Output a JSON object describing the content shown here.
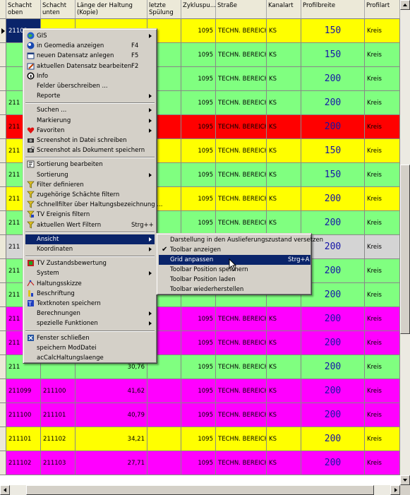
{
  "columns": [
    "",
    "Schacht oben",
    "Schacht unten",
    "Länge der Haltung (Kopie)",
    "letzte Spülung",
    "Zykluspu...",
    "Straße",
    "Kanalart",
    "Profilbreite",
    "Profilart"
  ],
  "colors": {
    "yellow": "#ffff00",
    "green": "#80ff80",
    "red": "#ff0000",
    "magenta": "#ff00ff",
    "grey": "#d4d4d4"
  },
  "rows": [
    {
      "c": "yellow",
      "s1": "21103",
      "s2": "",
      "len": "",
      "zy": "1095",
      "str": "TECHN. BEREICH",
      "ka": "KS",
      "pb": "150",
      "pa": "Kreis",
      "cur": true
    },
    {
      "c": "green",
      "s1": "",
      "s2": "",
      "len": "",
      "zy": "1095",
      "str": "TECHN. BEREICH",
      "ka": "KS",
      "pb": "150",
      "pa": "Kreis"
    },
    {
      "c": "green",
      "s1": "",
      "s2": "",
      "len": "",
      "zy": "1095",
      "str": "TECHN. BEREICH",
      "ka": "KS",
      "pb": "200",
      "pa": "Kreis"
    },
    {
      "c": "green",
      "s1": "211",
      "s2": "",
      "len": "",
      "zy": "1095",
      "str": "TECHN. BEREICH",
      "ka": "KS",
      "pb": "200",
      "pa": "Kreis"
    },
    {
      "c": "red",
      "s1": "211",
      "s2": "",
      "len": "",
      "zy": "1095",
      "str": "TECHN. BEREICH",
      "ka": "KS",
      "pb": "200",
      "pa": "Kreis"
    },
    {
      "c": "yellow",
      "s1": "211",
      "s2": "",
      "len": "",
      "zy": "1095",
      "str": "TECHN. BEREICH",
      "ka": "KS",
      "pb": "150",
      "pa": "Kreis"
    },
    {
      "c": "green",
      "s1": "211",
      "s2": "",
      "len": "",
      "zy": "1095",
      "str": "TECHN. BEREICH",
      "ka": "KS",
      "pb": "150",
      "pa": "Kreis"
    },
    {
      "c": "yellow",
      "s1": "211",
      "s2": "",
      "len": "",
      "zy": "1095",
      "str": "TECHN. BEREICH",
      "ka": "KS",
      "pb": "200",
      "pa": "Kreis"
    },
    {
      "c": "green",
      "s1": "211",
      "s2": "",
      "len": "",
      "zy": "1095",
      "str": "TECHN. BEREICH",
      "ka": "KS",
      "pb": "200",
      "pa": "Kreis"
    },
    {
      "c": "grey",
      "s1": "211",
      "s2": "",
      "len": "",
      "zy": "",
      "str": "",
      "ka": "",
      "pb": "200",
      "pa": "Kreis"
    },
    {
      "c": "green",
      "s1": "211",
      "s2": "",
      "len": "",
      "zy": "",
      "str": "",
      "ka": "",
      "pb": "200",
      "pa": "Kreis"
    },
    {
      "c": "green",
      "s1": "211",
      "s2": "",
      "len": "",
      "zy": "",
      "str": "",
      "ka": "",
      "pb": "200",
      "pa": "Kreis"
    },
    {
      "c": "magenta",
      "s1": "211",
      "s2": "",
      "len": "",
      "zy": "1095",
      "str": "TECHN. BEREICH",
      "ka": "KS",
      "pb": "200",
      "pa": "Kreis"
    },
    {
      "c": "magenta",
      "s1": "211",
      "s2": "",
      "len": "",
      "zy": "1095",
      "str": "TECHN. BEREICH",
      "ka": "KS",
      "pb": "200",
      "pa": "Kreis"
    },
    {
      "c": "green",
      "s1": "211",
      "s2": "",
      "len": "30,76",
      "zy": "1095",
      "str": "TECHN. BEREICH",
      "ka": "KS",
      "pb": "200",
      "pa": "Kreis"
    },
    {
      "c": "magenta",
      "s1": "211099",
      "s2": "211100",
      "len": "41,62",
      "zy": "1095",
      "str": "TECHN. BEREICH",
      "ka": "KS",
      "pb": "200",
      "pa": "Kreis"
    },
    {
      "c": "magenta",
      "s1": "211100",
      "s2": "211101",
      "len": "40,79",
      "zy": "1095",
      "str": "TECHN. BEREICH",
      "ka": "KS",
      "pb": "200",
      "pa": "Kreis"
    },
    {
      "c": "yellow",
      "s1": "211101",
      "s2": "211102",
      "len": "34,21",
      "zy": "1095",
      "str": "TECHN. BEREICH",
      "ka": "KS",
      "pb": "200",
      "pa": "Kreis"
    },
    {
      "c": "magenta",
      "s1": "211102",
      "s2": "211103",
      "len": "27,71",
      "zy": "1095",
      "str": "TECHN. BEREICH",
      "ka": "KS",
      "pb": "200",
      "pa": "Kreis"
    }
  ],
  "menu": [
    {
      "t": "item",
      "label": "GIS",
      "icon": "globe-icon",
      "sub": true
    },
    {
      "t": "item",
      "label": "in Geomedia anzeigen",
      "icon": "geomedia-icon",
      "shortcut": "F4"
    },
    {
      "t": "item",
      "label": "neuen Datensatz anlegen",
      "icon": "new-record-icon",
      "shortcut": "F5"
    },
    {
      "t": "item",
      "label": "aktuellen Datensatz bearbeiten",
      "icon": "edit-record-icon",
      "shortcut": "F2"
    },
    {
      "t": "item",
      "label": "Info",
      "icon": "info-icon"
    },
    {
      "t": "item",
      "label": "Felder überschreiben ..."
    },
    {
      "t": "item",
      "label": "Reporte",
      "sub": true
    },
    {
      "t": "sep"
    },
    {
      "t": "item",
      "label": "Suchen ...",
      "sub": true
    },
    {
      "t": "item",
      "label": "Markierung",
      "sub": true
    },
    {
      "t": "item",
      "label": "Favoriten",
      "icon": "heart-icon",
      "sub": true
    },
    {
      "t": "item",
      "label": "Screenshot in Datei schreiben",
      "icon": "camera-icon"
    },
    {
      "t": "item",
      "label": "Screenshot als Dokument speichern",
      "icon": "camera-doc-icon"
    },
    {
      "t": "sep"
    },
    {
      "t": "item",
      "label": "Sortierung bearbeiten",
      "icon": "sort-icon"
    },
    {
      "t": "item",
      "label": "Sortierung",
      "sub": true
    },
    {
      "t": "item",
      "label": "Filter definieren",
      "icon": "filter-icon"
    },
    {
      "t": "item",
      "label": "zugehörige Schächte filtern",
      "icon": "filter-icon"
    },
    {
      "t": "item",
      "label": "Schnellfilter über Haltungsbezeichnung ...",
      "icon": "filter-icon"
    },
    {
      "t": "item",
      "label": "TV Ereignis filtern",
      "icon": "tv-filter-icon"
    },
    {
      "t": "item",
      "label": "aktuellen Wert Filtern",
      "icon": "filter-icon",
      "shortcut": "Strg++"
    },
    {
      "t": "sep"
    },
    {
      "t": "item",
      "label": "Ansicht",
      "sub": true,
      "hl": true
    },
    {
      "t": "item",
      "label": "Koordinaten",
      "sub": true
    },
    {
      "t": "sep"
    },
    {
      "t": "item",
      "label": "TV Zustandsbewertung",
      "icon": "tv-icon"
    },
    {
      "t": "item",
      "label": "System",
      "sub": true
    },
    {
      "t": "item",
      "label": "Haltungsskizze",
      "icon": "sketch-icon"
    },
    {
      "t": "item",
      "label": "Beschriftung",
      "icon": "label-icon"
    },
    {
      "t": "item",
      "label": "Textknoten speichern",
      "icon": "text-node-icon"
    },
    {
      "t": "item",
      "label": "Berechnungen",
      "sub": true
    },
    {
      "t": "item",
      "label": "spezielle Funktionen",
      "sub": true
    },
    {
      "t": "sep"
    },
    {
      "t": "item",
      "label": "Fenster schließen",
      "icon": "close-window-icon"
    },
    {
      "t": "item",
      "label": "speichern ModDatei"
    },
    {
      "t": "item",
      "label": "acCalcHaltungslaenge"
    }
  ],
  "submenu": [
    {
      "label": "Darstellung in den Auslieferungszustand versetzen"
    },
    {
      "label": "Toolbar anzeigen",
      "checked": true
    },
    {
      "label": "Grid anpassen",
      "shortcut": "Strg+A",
      "hl": true
    },
    {
      "label": "Toolbar Position speichern"
    },
    {
      "label": "Toolbar Position  laden"
    },
    {
      "label": "Toolbar wiederherstellen"
    }
  ]
}
